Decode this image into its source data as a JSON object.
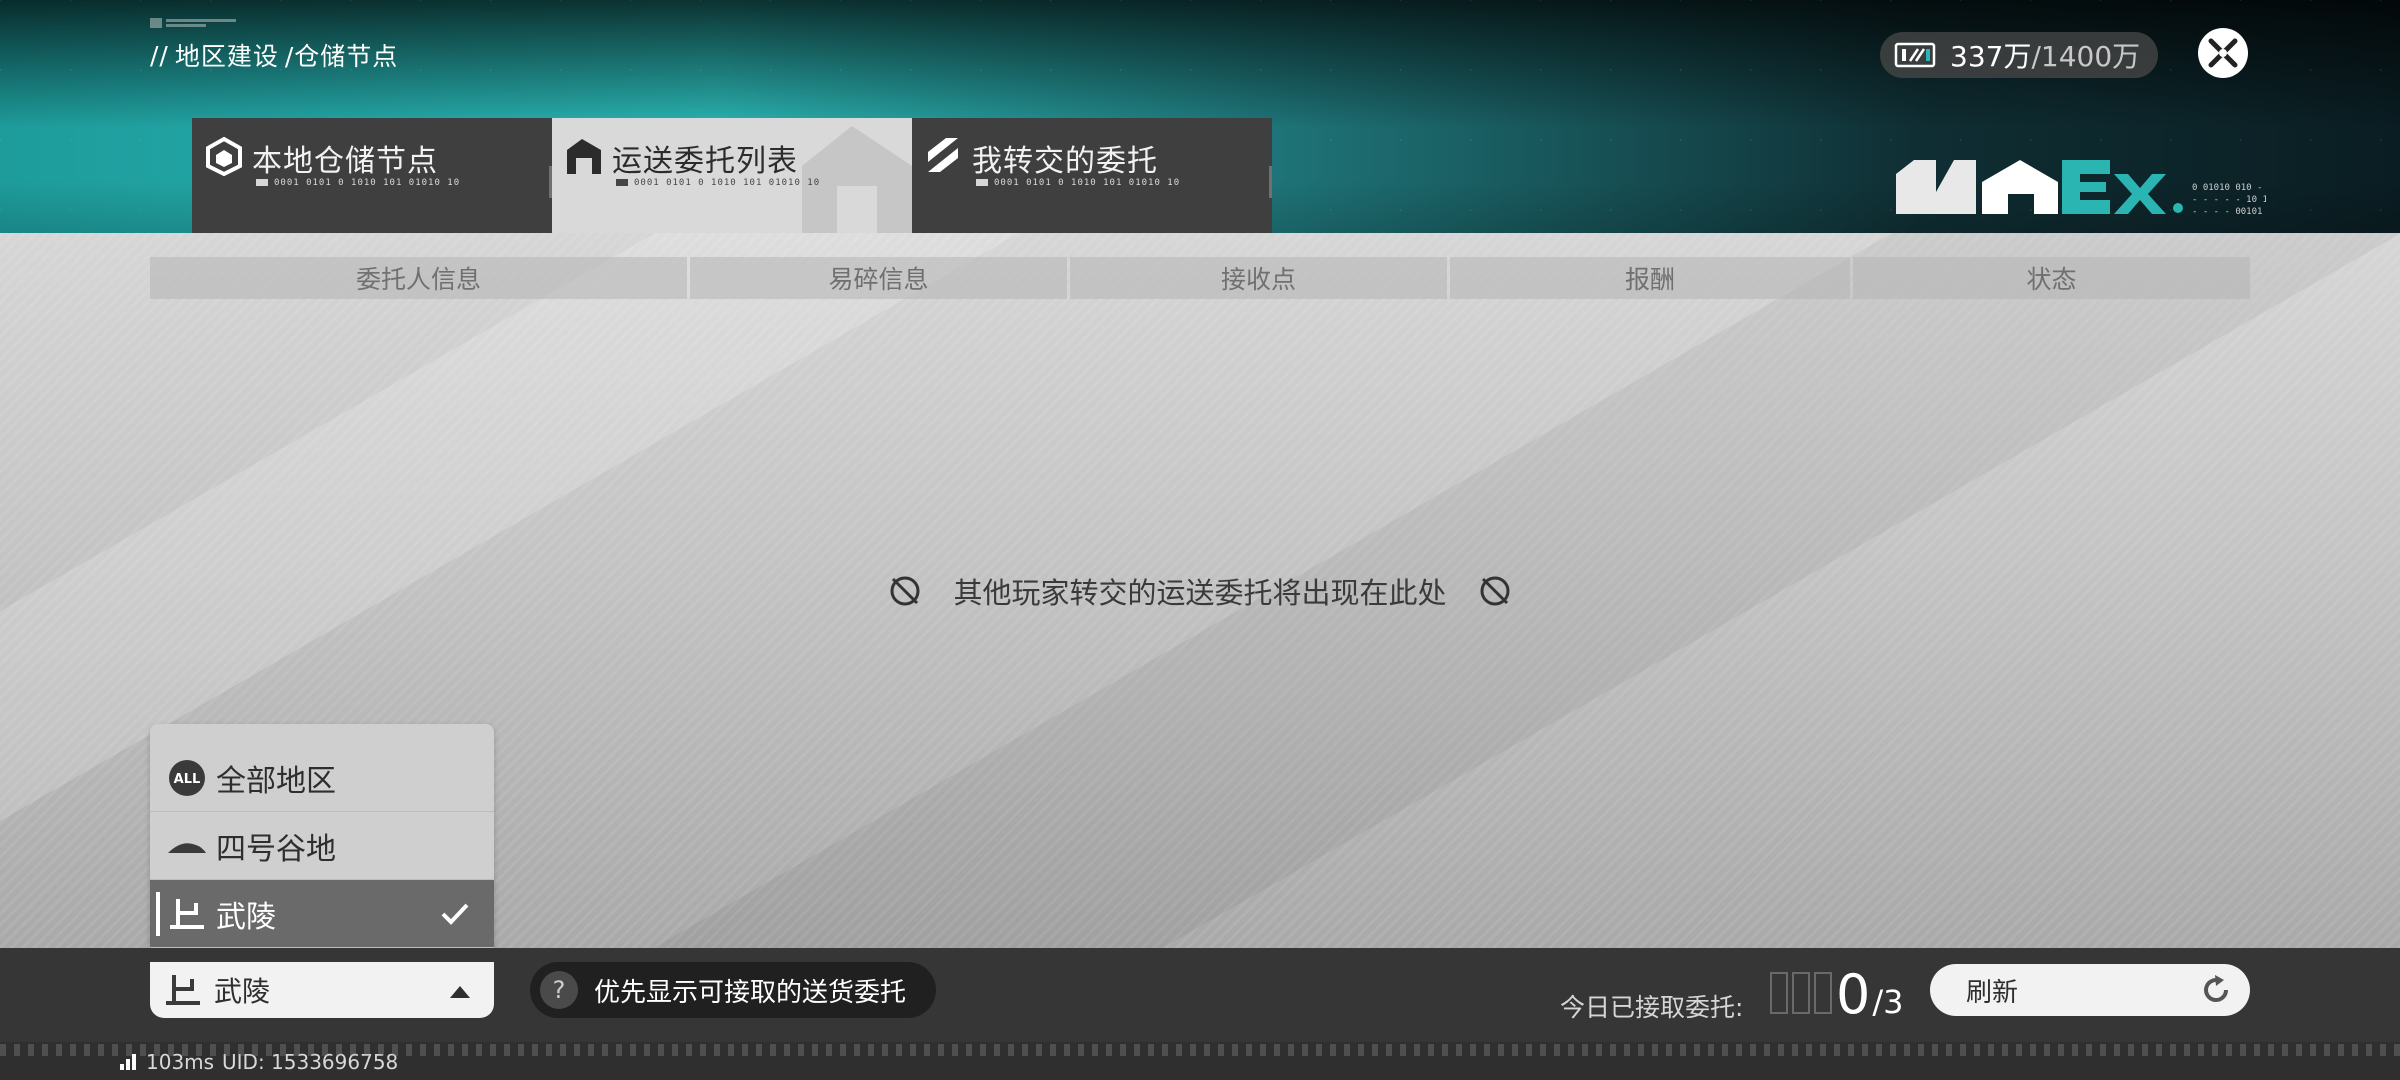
{
  "breadcrumb": {
    "prefix": "//",
    "parts": [
      "地区建设",
      "/仓储节点"
    ]
  },
  "currency": {
    "current": "337万",
    "max": "/1400万"
  },
  "tabs": [
    {
      "label": "本地仓储节点",
      "code": "0001 0101 0 1010 101 01010 10",
      "active": false,
      "icon": "warehouse-cube-icon"
    },
    {
      "label": "运送委托列表",
      "code": "0001 0101 0 1010 101 01010 10",
      "active": true,
      "icon": "delivery-house-icon"
    },
    {
      "label": "我转交的委托",
      "code": "0001 0101 0 1010 101 01010 10",
      "active": false,
      "icon": "transfer-stripes-icon"
    }
  ],
  "table": {
    "columns": [
      "委托人信息",
      "易碎信息",
      "接收点",
      "报酬",
      "状态"
    ]
  },
  "empty_message": "其他玩家转交的运送委托将出现在此处",
  "region_dropdown": {
    "options": [
      {
        "label": "全部地区",
        "icon": "all-regions-icon",
        "selected": false
      },
      {
        "label": "四号谷地",
        "icon": "valley-hill-icon",
        "selected": false
      },
      {
        "label": "武陵",
        "icon": "wuling-pagoda-icon",
        "selected": true
      }
    ],
    "current": "武陵"
  },
  "priority_toggle": {
    "label": "优先显示可接取的送货委托"
  },
  "today": {
    "label": "今日已接取委托:",
    "count": "0",
    "limit": "/3"
  },
  "refresh": {
    "label": "刷新"
  },
  "status": {
    "ping": "103ms",
    "uid": "UID: 1533696758"
  },
  "colors": {
    "accent_teal": "#2ab5b3",
    "tab_dark": "#3f3f3f",
    "tab_active": "#d9d9d9",
    "bottom_bar": "#363636"
  }
}
